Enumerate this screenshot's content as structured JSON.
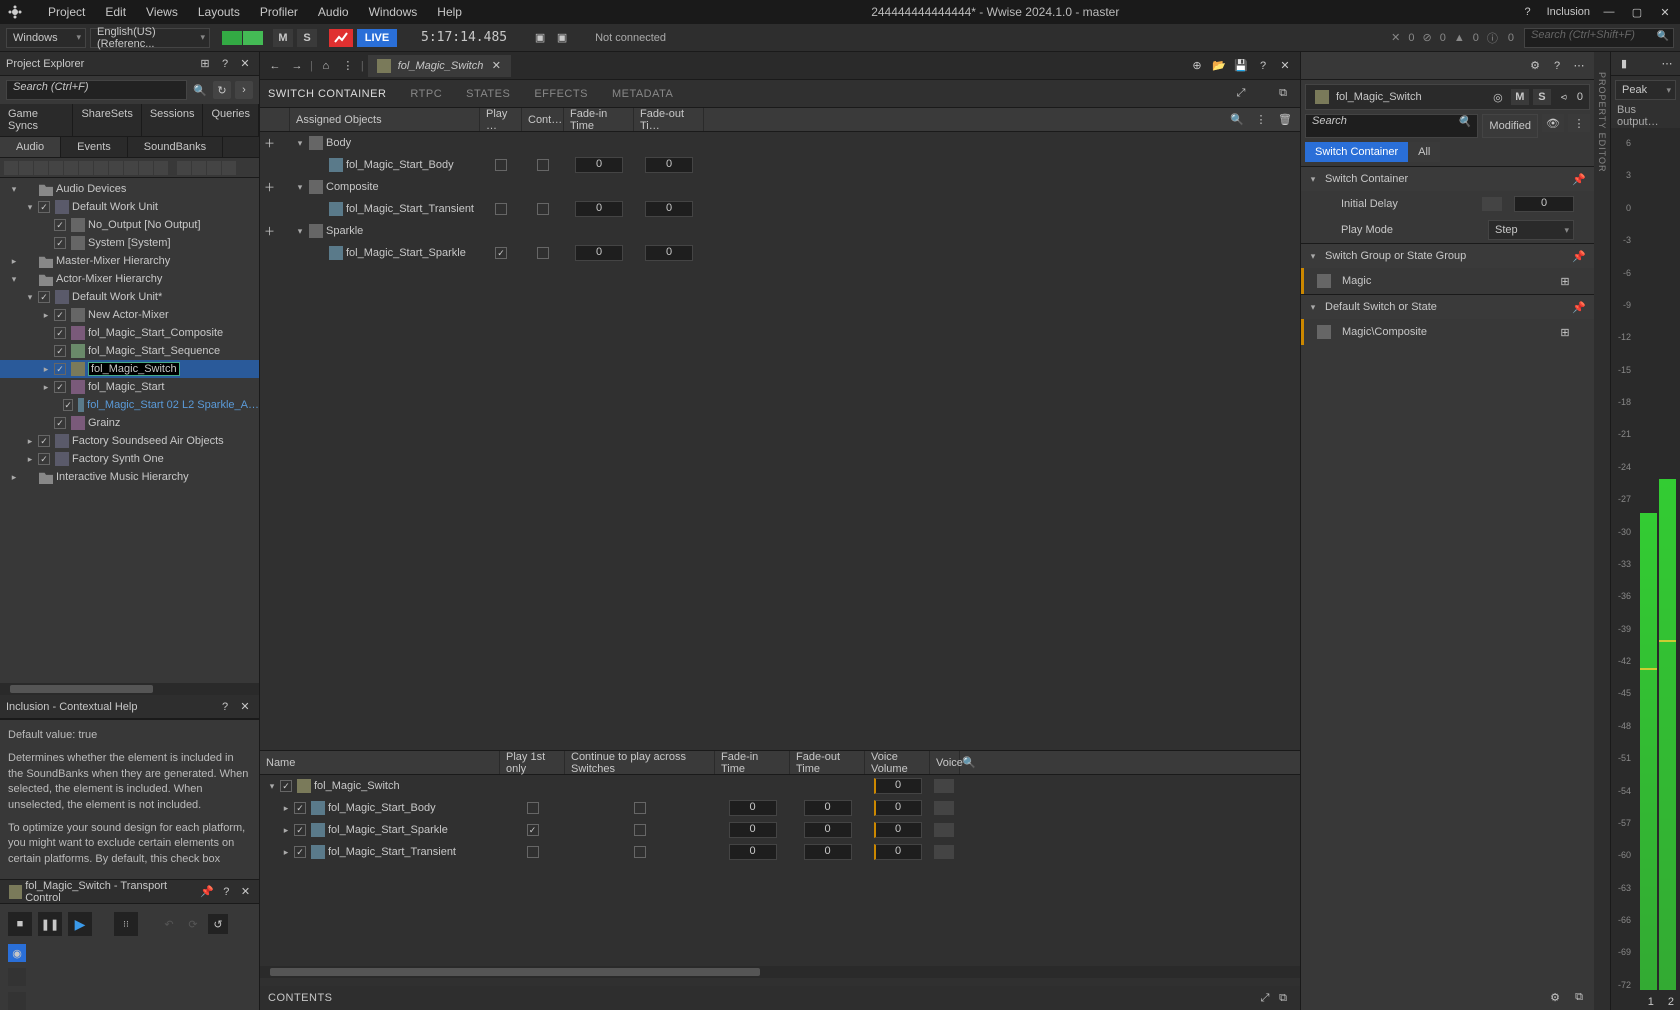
{
  "topbar": {
    "menus": [
      "Project",
      "Edit",
      "Views",
      "Layouts",
      "Profiler",
      "Audio",
      "Windows",
      "Help"
    ],
    "title": "244444444444444* - Wwise 2024.1.0  - master",
    "inclusion": "Inclusion"
  },
  "toolbar2": {
    "platform": "Windows",
    "language": "English(US) (Referenc...",
    "m": "M",
    "s": "S",
    "live": "LIVE",
    "timecode": "5:17:14.485",
    "status": "Not connected",
    "counts": [
      "0",
      "0",
      "0",
      "0"
    ],
    "search_ph": "Search (Ctrl+Shift+F)"
  },
  "projectExplorer": {
    "title": "Project Explorer",
    "search_ph": "Search (Ctrl+F)",
    "tabs1": [
      "Game Syncs",
      "ShareSets",
      "Sessions",
      "Queries"
    ],
    "tabs2": [
      "Audio",
      "Events",
      "SoundBanks"
    ],
    "tree": [
      {
        "d": 0,
        "exp": "▾",
        "ic": "folder",
        "label": "Audio Devices"
      },
      {
        "d": 1,
        "exp": "▾",
        "chk": true,
        "ic": "workunit",
        "label": "Default Work Unit"
      },
      {
        "d": 2,
        "chk": true,
        "ic": "bus",
        "label": "No_Output [No Output]"
      },
      {
        "d": 2,
        "chk": true,
        "ic": "bus",
        "label": "System [System]"
      },
      {
        "d": 0,
        "exp": "▸",
        "ic": "folder",
        "label": "Master-Mixer Hierarchy"
      },
      {
        "d": 0,
        "exp": "▾",
        "ic": "folder",
        "label": "Actor-Mixer Hierarchy"
      },
      {
        "d": 1,
        "exp": "▾",
        "chk": true,
        "ic": "workunit",
        "label": "Default Work Unit*"
      },
      {
        "d": 2,
        "exp": "▸",
        "chk": true,
        "ic": "am",
        "label": "New Actor-Mixer"
      },
      {
        "d": 2,
        "chk": true,
        "ic": "blend",
        "label": "fol_Magic_Start_Composite"
      },
      {
        "d": 2,
        "chk": true,
        "ic": "seq",
        "label": "fol_Magic_Start_Sequence"
      },
      {
        "d": 2,
        "exp": "▸",
        "chk": true,
        "ic": "sc",
        "label": "fol_Magic_Switch",
        "sel": true
      },
      {
        "d": 2,
        "exp": "▸",
        "chk": true,
        "ic": "blend",
        "label": "fol_Magic_Start"
      },
      {
        "d": 3,
        "chk": true,
        "ic": "snd",
        "label": "fol_Magic_Start 02 L2 Sparkle_A…",
        "link": true
      },
      {
        "d": 2,
        "chk": true,
        "ic": "blend",
        "label": "Grainz"
      },
      {
        "d": 1,
        "exp": "▸",
        "chk": true,
        "ic": "workunit",
        "label": "Factory Soundseed Air Objects"
      },
      {
        "d": 1,
        "exp": "▸",
        "chk": true,
        "ic": "workunit",
        "label": "Factory Synth One"
      },
      {
        "d": 0,
        "exp": "▸",
        "ic": "folder",
        "label": "Interactive Music Hierarchy"
      }
    ]
  },
  "help": {
    "title": "Inclusion - Contextual Help",
    "p1": "Default value: true",
    "p2": "Determines whether the element is included in the SoundBanks when they are generated. When selected, the element is included. When unselected, the element is not included.",
    "p3": "To optimize your sound design for each platform, you might want to exclude certain elements on certain platforms. By default, this check box"
  },
  "transport": {
    "title": "fol_Magic_Switch - Transport Control"
  },
  "breadcrumb": {
    "item": "fol_Magic_Switch"
  },
  "centerTabs": [
    "SWITCH CONTAINER",
    "RTPC",
    "STATES",
    "EFFECTS",
    "METADATA"
  ],
  "switchGrid": {
    "headers": [
      "Assigned Objects",
      "Play …",
      "Cont…",
      "Fade-in Time",
      "Fade-out Ti…"
    ],
    "groups": [
      {
        "name": "Body",
        "children": [
          {
            "name": "fol_Magic_Start_Body",
            "play": false,
            "fi": "0",
            "fo": "0"
          }
        ]
      },
      {
        "name": "Composite",
        "children": [
          {
            "name": "fol_Magic_Start_Transient",
            "play": false,
            "fi": "0",
            "fo": "0"
          }
        ]
      },
      {
        "name": "Sparkle",
        "children": [
          {
            "name": "fol_Magic_Start_Sparkle",
            "play": true,
            "fi": "0",
            "fo": "0"
          }
        ]
      }
    ]
  },
  "contents": {
    "title": "CONTENTS",
    "headers": [
      "Name",
      "Play 1st only",
      "Continue to play across Switches",
      "Fade-in Time",
      "Fade-out Time",
      "Voice Volume",
      "Voice"
    ],
    "rows": [
      {
        "exp": "▾",
        "name": "fol_Magic_Switch",
        "isParent": true,
        "vv": "0"
      },
      {
        "exp": "▸",
        "name": "fol_Magic_Start_Body",
        "play": false,
        "cont": false,
        "fi": "0",
        "fo": "0",
        "vv": "0"
      },
      {
        "exp": "▸",
        "name": "fol_Magic_Start_Sparkle",
        "play": true,
        "cont": false,
        "fi": "0",
        "fo": "0",
        "vv": "0"
      },
      {
        "exp": "▸",
        "name": "fol_Magic_Start_Transient",
        "play": false,
        "cont": false,
        "fi": "0",
        "fo": "0",
        "vv": "0"
      }
    ]
  },
  "propEditor": {
    "obj": "fol_Magic_Switch",
    "m": "M",
    "s": "S",
    "share": "0",
    "search_ph": "Search",
    "modified": "Modified",
    "tabs": [
      "Switch Container",
      "All"
    ],
    "sections": [
      {
        "title": "Switch Container",
        "rows": [
          {
            "label": "Initial Delay",
            "ctrl": "num",
            "val": "0"
          },
          {
            "label": "Play Mode",
            "ctrl": "combo",
            "val": "Step"
          }
        ]
      },
      {
        "title": "Switch Group or State Group",
        "rows": [
          {
            "label": "Magic",
            "ctrl": "ref"
          }
        ]
      },
      {
        "title": "Default Switch or State",
        "rows": [
          {
            "label": "Magic\\Composite",
            "ctrl": "ref"
          }
        ]
      }
    ],
    "vtext": "PROPERTY EDITOR"
  },
  "meter": {
    "title": "Peak",
    "sub": "Bus output…",
    "scale": [
      "6",
      "3",
      "0",
      "-3",
      "-6",
      "-9",
      "-12",
      "-15",
      "-18",
      "-21",
      "-24",
      "-27",
      "-30",
      "-33",
      "-36",
      "-39",
      "-42",
      "-45",
      "-48",
      "-51",
      "-54",
      "-57",
      "-60",
      "-63",
      "-66",
      "-69",
      "-72"
    ],
    "ch": [
      "1",
      "2"
    ],
    "bar_heights": [
      "56%",
      "60%"
    ],
    "peak_pos": [
      "67%",
      "68%"
    ]
  }
}
